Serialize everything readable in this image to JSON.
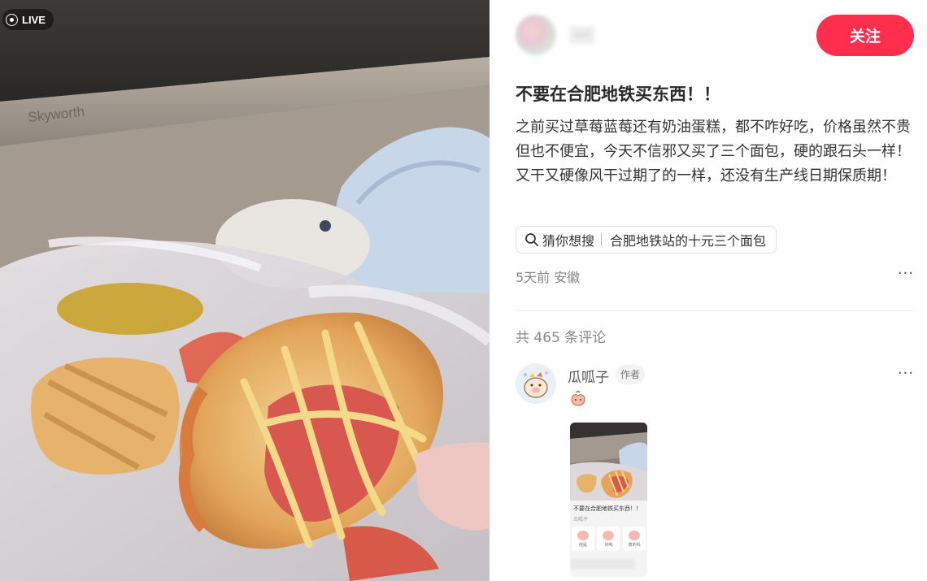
{
  "photo": {
    "live_label": "LIVE",
    "tv_brand": "Skyworth"
  },
  "author": {
    "name": "····",
    "follow_label": "关注"
  },
  "note": {
    "title": "不要在合肥地铁买东西！！",
    "body": "之前买过草莓蓝莓还有奶油蛋糕，都不咋好吃，价格虽然不贵但也不便宜，今天不信邪又买了三个面包，硬的跟石头一样！又干又硬像风干过期了的一样，还没有生产线日期保质期！",
    "search_prefix": "猜你想搜",
    "search_query": "合肥地铁站的十元三个面包",
    "meta": "5天前 安徽",
    "more_label": "···"
  },
  "comments": {
    "count_text": "共 465 条评论",
    "items": [
      {
        "name": "瓜呱子",
        "tag": "作者",
        "more_label": "···",
        "thumb_caption": "不要在合肥地铁买东西！！",
        "thumb_sub": "瓜呱子",
        "stickers": [
          "他是",
          "好喝",
          "真的吗"
        ]
      }
    ]
  },
  "colors": {
    "follow_bg": "#ff2e4d",
    "text_primary": "#333333",
    "text_secondary": "#888888"
  }
}
